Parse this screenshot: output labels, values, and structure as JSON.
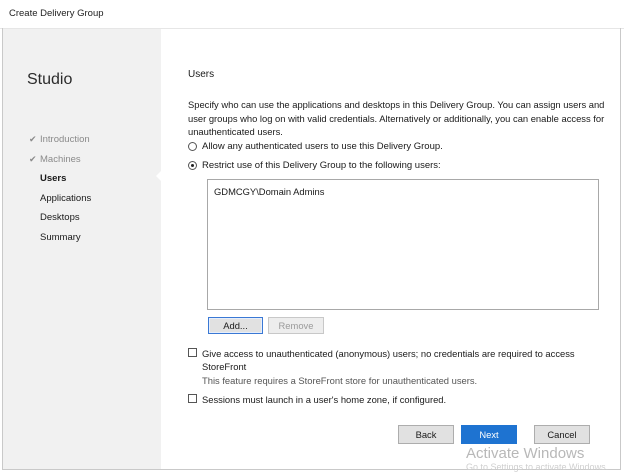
{
  "window": {
    "title": "Create Delivery Group"
  },
  "sidebar": {
    "brand": "Studio",
    "items": [
      {
        "label": "Introduction",
        "state": "done"
      },
      {
        "label": "Machines",
        "state": "done"
      },
      {
        "label": "Users",
        "state": "current"
      },
      {
        "label": "Applications",
        "state": "pending"
      },
      {
        "label": "Desktops",
        "state": "pending"
      },
      {
        "label": "Summary",
        "state": "pending"
      }
    ],
    "check_glyph": "✔"
  },
  "main": {
    "heading": "Users",
    "description": "Specify who can use the applications and desktops in this Delivery Group. You can assign users and user groups who log on with valid credentials. Alternatively or additionally, you can enable access for unauthenticated users.",
    "radio_any": {
      "label": "Allow any authenticated users to use this Delivery Group.",
      "selected": false
    },
    "radio_restrict": {
      "label": "Restrict use of this Delivery Group to the following users:",
      "selected": true
    },
    "users": [
      "GDMCGY\\Domain Admins"
    ],
    "add_button": "Add...",
    "remove_button": "Remove",
    "unauth_checkbox": {
      "label_line1": "Give access to unauthenticated (anonymous) users; no credentials are required to access",
      "label_line2": "StoreFront",
      "note": "This feature requires a StoreFront store for unauthenticated users.",
      "checked": false
    },
    "home_zone_checkbox": {
      "label": "Sessions must launch in a user's home zone, if configured.",
      "checked": false
    }
  },
  "footer": {
    "back": "Back",
    "next": "Next",
    "cancel": "Cancel"
  },
  "watermark": {
    "title": "Activate Windows",
    "subtitle": "Go to Settings to activate Windows."
  },
  "colors": {
    "sidebar_bg": "#f1f1f1",
    "primary_button": "#1e73d1"
  }
}
